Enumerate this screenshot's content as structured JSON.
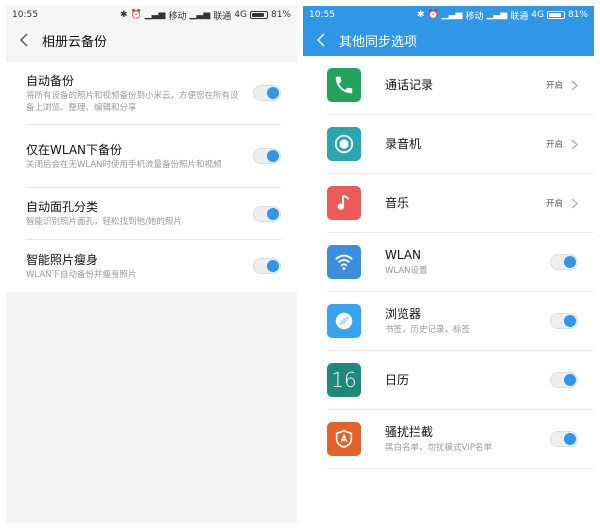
{
  "left": {
    "status_time": "10:55",
    "status_carrier1": "移动",
    "status_carrier2": "联通",
    "status_network": "4G",
    "status_battery": "81%",
    "title": "相册云备份",
    "items": [
      {
        "title": "自动备份",
        "desc": "将所有设备的照片和视频备份到小米云，方便您在所有设备上浏览、整理、编辑和分享",
        "enabled": true
      },
      {
        "title": "仅在WLAN下备份",
        "desc": "关闭后会在无WLAN时使用手机流量备份照片和视频",
        "enabled": true
      },
      {
        "title": "自动面孔分类",
        "desc": "智能识别照片面孔，轻松找到他/她的照片",
        "enabled": true
      },
      {
        "title": "智能照片瘦身",
        "desc": "WLAN下自动备份并瘦身照片",
        "enabled": true
      }
    ]
  },
  "right": {
    "status_time": "10:55",
    "status_carrier1": "移动",
    "status_carrier2": "联通",
    "status_network": "4G",
    "status_battery": "81%",
    "title": "其他同步选项",
    "items": [
      {
        "title": "通话记录",
        "subtitle": "",
        "status": "开启",
        "control": "chevron",
        "icon": "phone-icon",
        "color": "#22a35a"
      },
      {
        "title": "录音机",
        "subtitle": "",
        "status": "开启",
        "control": "chevron",
        "icon": "recorder-icon",
        "color": "#2aa6b0"
      },
      {
        "title": "音乐",
        "subtitle": "",
        "status": "开启",
        "control": "chevron",
        "icon": "music-note-icon",
        "color": "#ec5a5a"
      },
      {
        "title": "WLAN",
        "subtitle": "WLAN设置",
        "status": "",
        "control": "toggle",
        "icon": "wifi-icon",
        "color": "#3a8fde"
      },
      {
        "title": "浏览器",
        "subtitle": "书签，历史记录，标签",
        "status": "",
        "control": "toggle",
        "icon": "browser-icon",
        "color": "#3aa3ee"
      },
      {
        "title": "日历",
        "subtitle": "",
        "status": "",
        "control": "toggle",
        "icon": "calendar-icon",
        "color": "#1f8a7c"
      },
      {
        "title": "骚扰拦截",
        "subtitle": "黑白名单，勿扰模式VIP名单",
        "status": "",
        "control": "toggle",
        "icon": "shield-icon",
        "color": "#e2622b"
      }
    ]
  },
  "calendar_icon_text": "16",
  "accent_color": "#2f96e8"
}
